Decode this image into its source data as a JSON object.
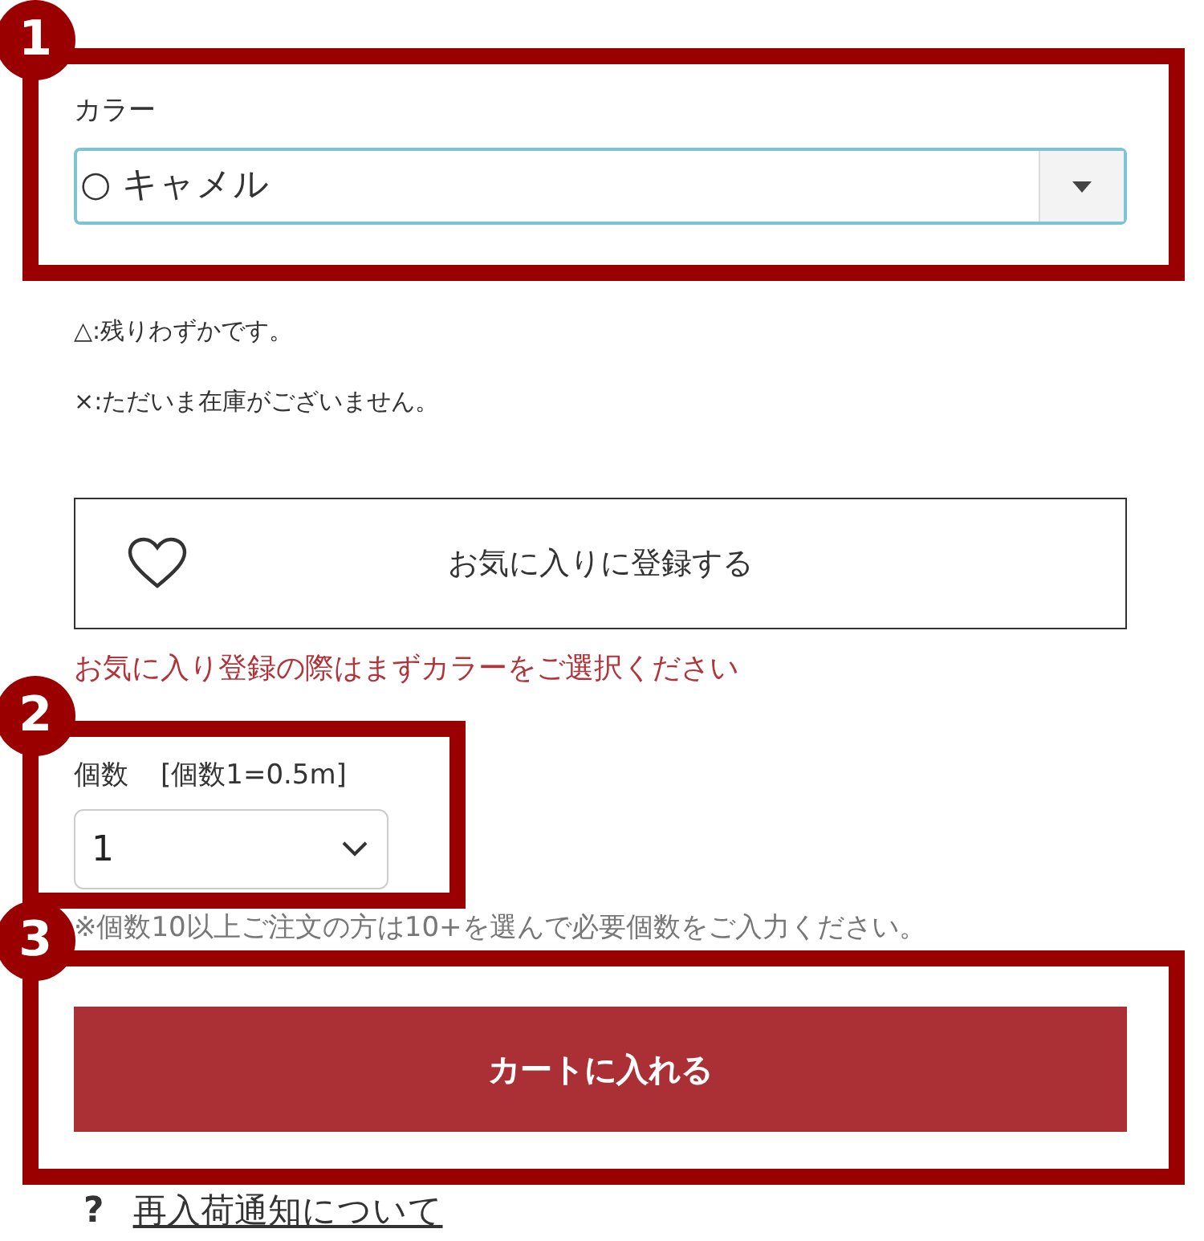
{
  "color_section": {
    "annotation": "1",
    "label": "カラー",
    "select": {
      "value": "○ キャメル"
    }
  },
  "stock_legend": [
    "△:残りわずかです。",
    "×:ただいま在庫がございません。"
  ],
  "favorite_button": {
    "label": "お気に入りに登録する"
  },
  "favorite_note": "お気に入り登録の際はまずカラーをご選択ください",
  "quantity_section": {
    "annotation": "2",
    "label": "個数",
    "unit_note": "[個数1=0.5m]",
    "select": {
      "value": "1"
    }
  },
  "quantity_note": "※個数10以上ご注文の方は10+を選んで必要個数をご入力ください。",
  "cart_section": {
    "annotation": "3",
    "button": "カートに入れる"
  },
  "restock_link": {
    "icon": "?",
    "text": "再入荷通知について"
  }
}
